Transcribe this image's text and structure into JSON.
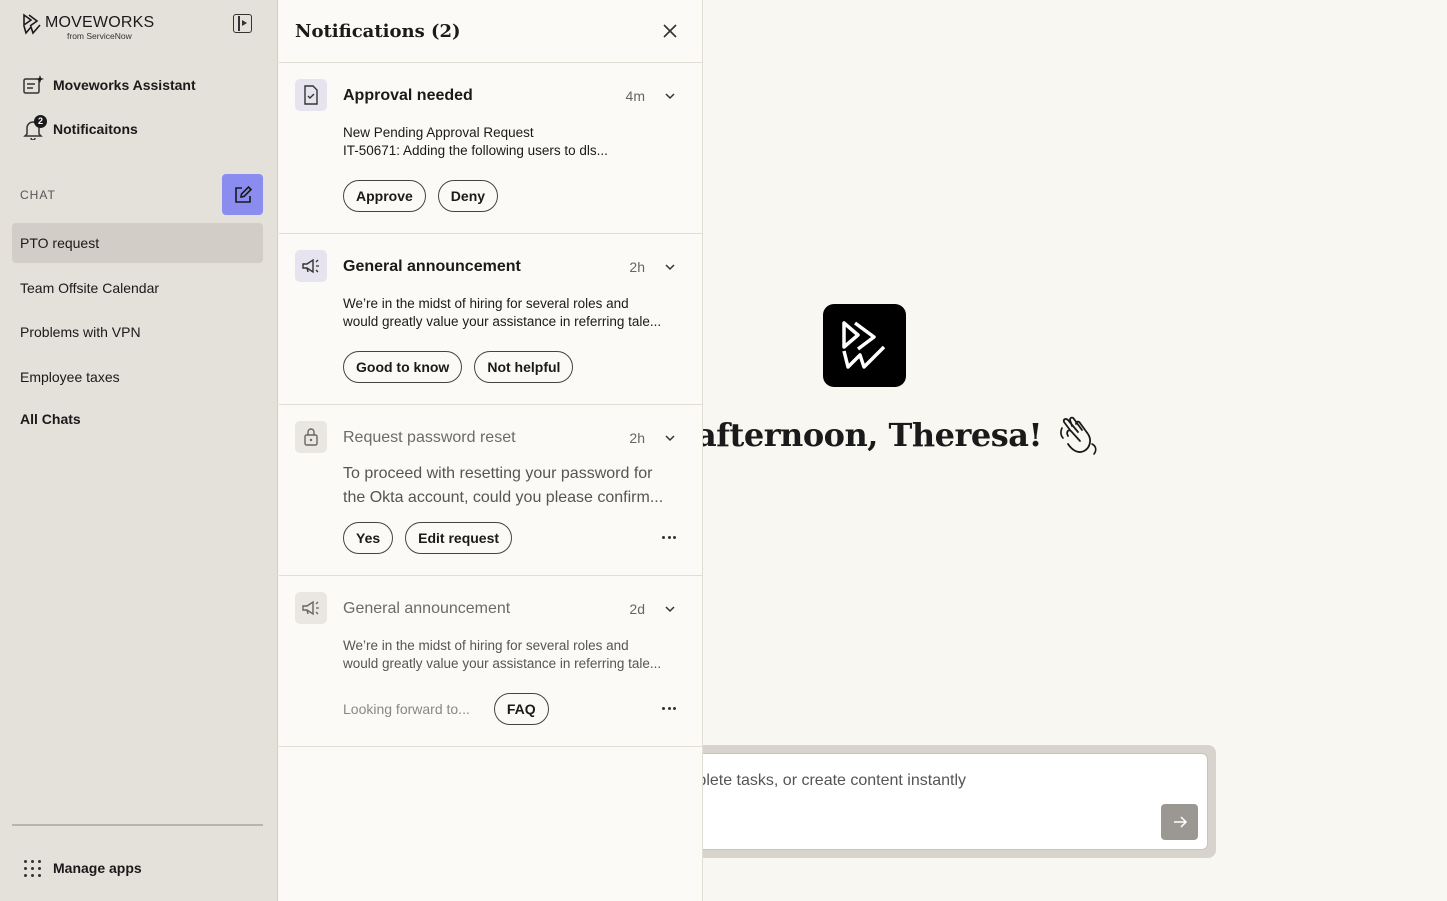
{
  "brand": {
    "name": "MOVEWORKS",
    "sub": "from ServiceNow"
  },
  "sidebar": {
    "assistant_label": "Moveworks Assistant",
    "notifications_label": "Notificaitons",
    "notifications_count": "2",
    "chat_section": "CHAT",
    "chats": [
      {
        "label": "PTO request",
        "active": true
      },
      {
        "label": "Team Offsite Calendar"
      },
      {
        "label": "Problems with VPN"
      },
      {
        "label": "Employee taxes"
      }
    ],
    "all_chats": "All Chats",
    "manage_apps": "Manage apps"
  },
  "notifications": {
    "title": "Notifications (2)",
    "items": [
      {
        "icon": "approval-document-icon",
        "title": "Approval needed",
        "time": "4m",
        "lines": [
          "New Pending Approval Request",
          "IT-50671: Adding the following users to dls..."
        ],
        "actions": [
          "Approve",
          "Deny"
        ]
      },
      {
        "icon": "megaphone-icon",
        "title": "General announcement",
        "time": "2h",
        "lines": [
          "We’re in the midst of hiring for several roles and",
          "would greatly value your assistance in referring tale..."
        ],
        "actions": [
          "Good to know",
          "Not helpful"
        ]
      },
      {
        "icon": "lock-icon",
        "title": "Request password reset",
        "time": "2h",
        "lines": [
          "To proceed with resetting your password for",
          "the Okta account, could you please confirm..."
        ],
        "actions": [
          "Yes",
          "Edit request"
        ]
      },
      {
        "icon": "megaphone-icon",
        "title": "General announcement",
        "time": "2d",
        "lines": [
          "We’re in the midst of hiring for several roles and",
          "would greatly value your assistance in referring tale..."
        ],
        "muted_text": "Looking forward to...",
        "actions": [
          "FAQ"
        ]
      }
    ]
  },
  "main": {
    "greeting": "Good afternoon, Theresa!",
    "composer_placeholder": "Ask anything, complete tasks, or create content instantly"
  },
  "colors": {
    "accent": "#8a8cf0",
    "sidebar_bg": "#e4e0da",
    "panel_bg": "#fbfaf6",
    "main_bg": "#f9f7f2"
  }
}
